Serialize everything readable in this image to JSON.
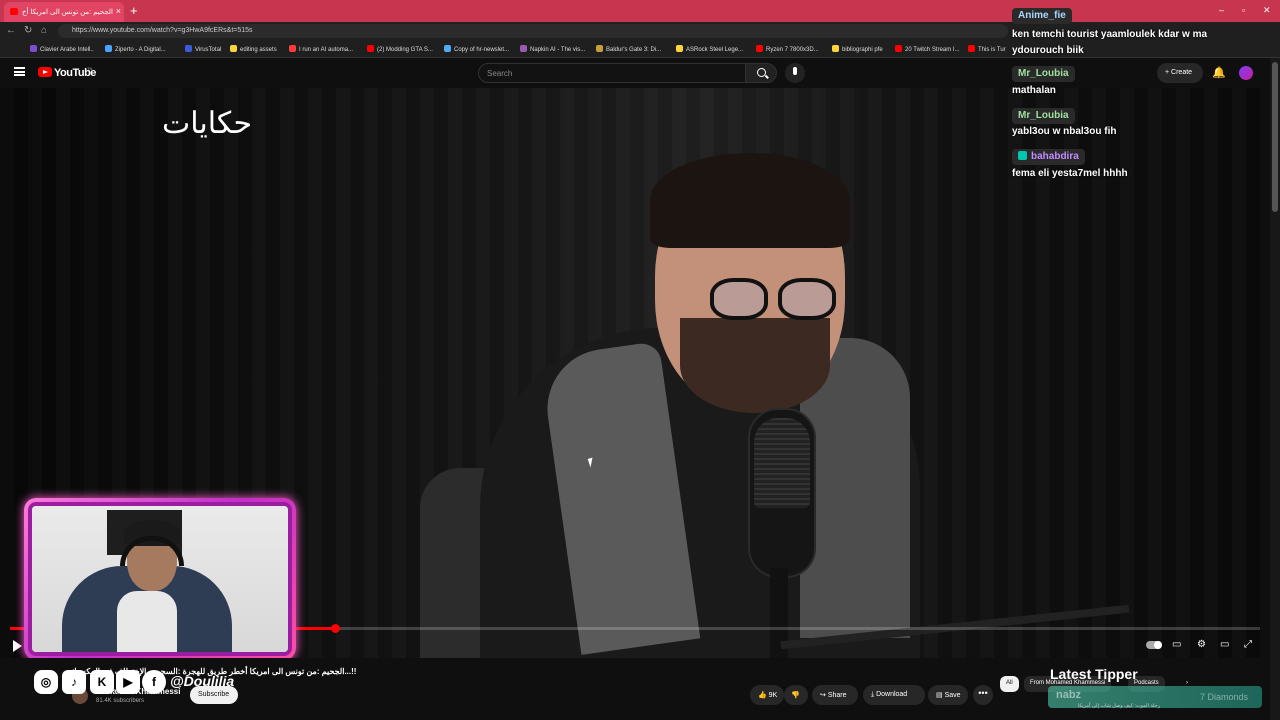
{
  "browser": {
    "tab_title": "الجحيم :من تونس الى امريكا أخ",
    "url": "https://www.youtube.com/watch?v=g3HwA9fcERs&t=515s",
    "bookmarks": [
      {
        "label": "Clavier Arabe Intell..",
        "color": "#7b4dd1"
      },
      {
        "label": "Ziperto - A Digital...",
        "color": "#4aa3ff"
      },
      {
        "label": "VirusTotal",
        "color": "#3b5bdb"
      },
      {
        "label": "editing assets",
        "color": "#ffd43b"
      },
      {
        "label": "I run an AI automa...",
        "color": "#ff3b3b"
      },
      {
        "label": "(2) Modding GTA S...",
        "color": "#ff0000"
      },
      {
        "label": "Copy of hr-newslet...",
        "color": "#4dabf7"
      },
      {
        "label": "Napkin AI - The vis...",
        "color": "#9b59b6"
      },
      {
        "label": "Baldur's Gate 3: Di...",
        "color": "#c99b3b"
      },
      {
        "label": "ASRock Steel Lege...",
        "color": "#ffd43b"
      },
      {
        "label": "Ryzen 7 7800x3D...",
        "color": "#ff0000"
      },
      {
        "label": "bibliographi pfe",
        "color": "#ffd43b"
      },
      {
        "label": "20 Twitch Stream I...",
        "color": "#ff0000"
      },
      {
        "label": "This is Tur",
        "color": "#ff0000"
      }
    ]
  },
  "youtube": {
    "logo_text": "YouTube",
    "logo_sup": "TN",
    "search_placeholder": "Search",
    "create_label": "Create",
    "overlay_logo": "حكايات",
    "video_title": "الجحيم :من تونس الى امريكا أخطر طريق للهجرة :السجن و الإختطاف في المكسيك...!!",
    "channel_name": "Mohamed Khammessi",
    "subscribers": "81.4K subscribers",
    "subscribe_label": "Subscribe",
    "likes": "9K",
    "share_label": "Share",
    "download_label": "Download",
    "save_label": "Save",
    "more_label": "•••",
    "chips": [
      "All",
      "From Mohamed Khammessi",
      "Podcasts"
    ],
    "progress": 0.26,
    "rec_text": "رحلة الموت: كيف وصل شاب إلى أمريكا"
  },
  "stream_overlay": {
    "social_handle": "@Doulilia",
    "latest_tipper_title": "Latest Tipper",
    "tipper_name": "nabz",
    "tipper_amount": "7 Diamonds"
  },
  "chat": [
    {
      "user": "Anime_fie",
      "message": "ken temchi tourist yaamloulek kdar w ma ydourouch biik",
      "color": "#a9d6ff"
    },
    {
      "user": "Mr_Loubia",
      "message": "mathalan",
      "color": "#9fe29f"
    },
    {
      "user": "Mr_Loubia",
      "message": "yabl3ou w nbal3ou fih",
      "color": "#9fe29f"
    },
    {
      "user": "bahabdira",
      "message": "fema eli yesta7mel hhhh",
      "color": "#c38cff"
    }
  ]
}
